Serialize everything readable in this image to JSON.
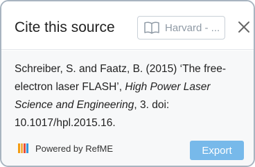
{
  "header": {
    "title": "Cite this source",
    "style_label": "Harvard - ...",
    "style_icon": "book-open-icon",
    "close_icon": "close-icon"
  },
  "citation": {
    "part1": "Schreiber, S. and Faatz, B. (2015) ‘The free-electron laser FLASH’, ",
    "journal": "High Power Laser Science and Engineering",
    "part2": ", 3. doi: 10.1017/hpl.2015.16."
  },
  "footer": {
    "powered_by": "Powered by RefME",
    "export_label": "Export"
  },
  "colors": {
    "export_button": "#77b9ea",
    "logo_orange": "#f39c12",
    "logo_red": "#e74c3c",
    "logo_blue": "#3498db"
  }
}
